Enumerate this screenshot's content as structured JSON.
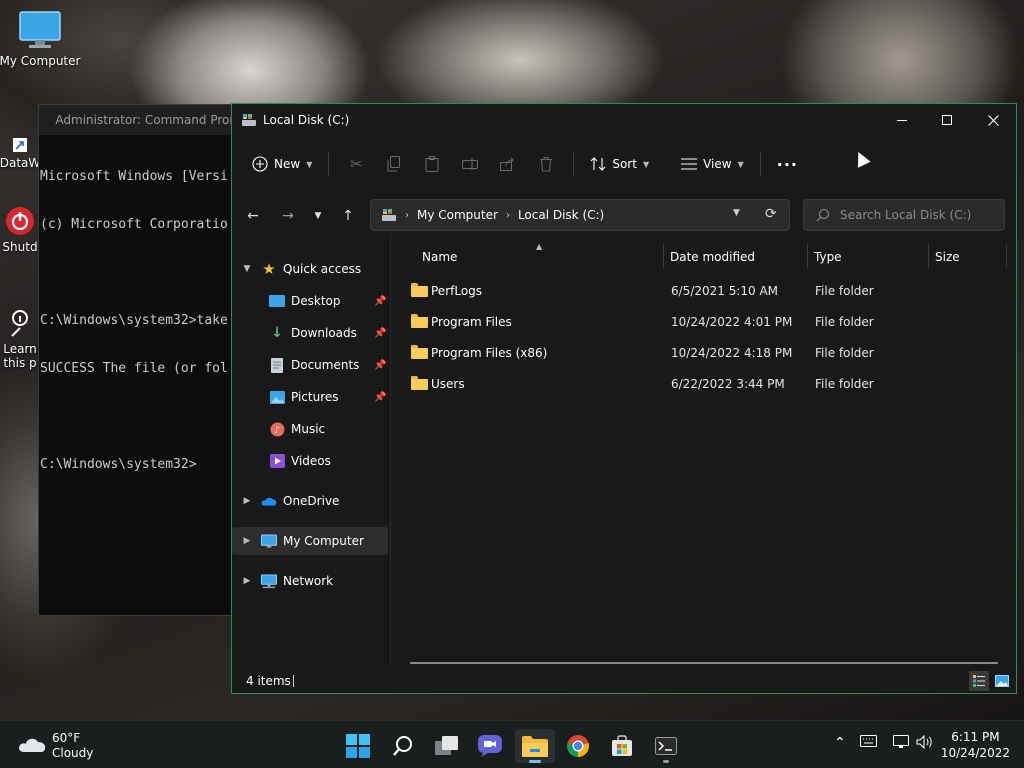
{
  "desktop": {
    "icons": [
      {
        "label": "My Computer"
      },
      {
        "label": "DataW"
      },
      {
        "label": "Shutd"
      },
      {
        "label": "Learn\nthis p"
      }
    ]
  },
  "cmd": {
    "title": "Administrator: Command Pron",
    "lines": [
      "Microsoft Windows [Versi",
      "(c) Microsoft Corporatio",
      "",
      "C:\\Windows\\system32>take",
      "SUCCESS The file (or fol",
      "",
      "C:\\Windows\\system32>"
    ]
  },
  "explorer": {
    "title": "Local Disk (C:)",
    "toolbar": {
      "new_label": "New",
      "sort_label": "Sort",
      "view_label": "View",
      "more_label": "···"
    },
    "address": {
      "crumb1": "My Computer",
      "crumb2": "Local Disk (C:)"
    },
    "search": {
      "placeholder": "Search Local Disk (C:)"
    },
    "nav": {
      "quick_access": "Quick access",
      "desktop": "Desktop",
      "downloads": "Downloads",
      "documents": "Documents",
      "pictures": "Pictures",
      "music": "Music",
      "videos": "Videos",
      "onedrive": "OneDrive",
      "my_computer": "My Computer",
      "network": "Network"
    },
    "columns": {
      "name": "Name",
      "date": "Date modified",
      "type": "Type",
      "size": "Size"
    },
    "files": [
      {
        "name": "PerfLogs",
        "date": "6/5/2021 5:10 AM",
        "type": "File folder"
      },
      {
        "name": "Program Files",
        "date": "10/24/2022 4:01 PM",
        "type": "File folder"
      },
      {
        "name": "Program Files (x86)",
        "date": "10/24/2022 4:18 PM",
        "type": "File folder"
      },
      {
        "name": "Users",
        "date": "6/22/2022 3:44 PM",
        "type": "File folder"
      }
    ],
    "status": "4 items"
  },
  "taskbar": {
    "weather_temp": "60°F",
    "weather_desc": "Cloudy",
    "time": "6:11 PM",
    "date": "10/24/2022"
  },
  "colors": {
    "accent": "#2e8b57",
    "folder": "#f6cd5a",
    "star": "#f2c230"
  }
}
